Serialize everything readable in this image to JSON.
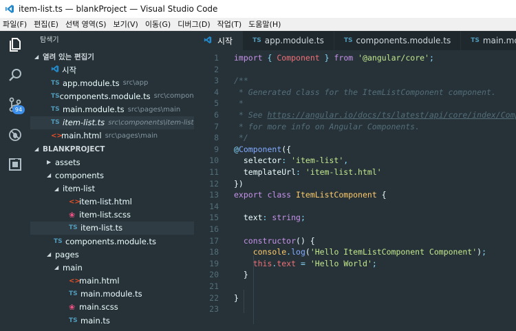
{
  "window": {
    "title": "item-list.ts — blankProject — Visual Studio Code"
  },
  "menu": [
    "파일(F)",
    "편집(E)",
    "선택 영역(S)",
    "보기(V)",
    "이동(G)",
    "디버그(D)",
    "작업(T)",
    "도움말(H)"
  ],
  "activity": {
    "items": [
      "explorer-icon",
      "search-icon",
      "source-control-icon",
      "debug-icon",
      "extensions-icon"
    ],
    "badge": "94"
  },
  "explorer": {
    "title": "탐색기",
    "open_editors_header": "열려 있는 편집기",
    "open_editors": [
      {
        "icon": "vscode",
        "name": "시작",
        "desc": ""
      },
      {
        "icon": "ts",
        "name": "app.module.ts",
        "desc": "src\\app"
      },
      {
        "icon": "ts",
        "name": "components.module.ts",
        "desc": "src\\compone..."
      },
      {
        "icon": "ts",
        "name": "main.module.ts",
        "desc": "src\\pages\\main"
      },
      {
        "icon": "ts",
        "name": "item-list.ts",
        "desc": "src\\components\\item-list"
      },
      {
        "icon": "html",
        "name": "main.html",
        "desc": "src\\pages\\main"
      }
    ],
    "project_header": "BLANKPROJECT",
    "tree": [
      {
        "type": "folder",
        "name": "assets",
        "expanded": false
      },
      {
        "type": "folder",
        "name": "components",
        "expanded": true
      },
      {
        "type": "folder",
        "name": "item-list",
        "expanded": true
      },
      {
        "type": "html",
        "name": "item-list.html"
      },
      {
        "type": "scss",
        "name": "item-list.scss"
      },
      {
        "type": "ts",
        "name": "item-list.ts"
      },
      {
        "type": "ts",
        "name": "components.module.ts"
      },
      {
        "type": "folder",
        "name": "pages",
        "expanded": true
      },
      {
        "type": "folder",
        "name": "main",
        "expanded": true
      },
      {
        "type": "html",
        "name": "main.html"
      },
      {
        "type": "ts",
        "name": "main.module.ts"
      },
      {
        "type": "scss",
        "name": "main.scss"
      },
      {
        "type": "ts",
        "name": "main.ts"
      }
    ]
  },
  "tabs": [
    {
      "icon": "vscode",
      "label": "시작",
      "active": true
    },
    {
      "icon": "ts",
      "label": "app.module.ts",
      "active": false
    },
    {
      "icon": "ts",
      "label": "components.module.ts",
      "active": false
    },
    {
      "icon": "ts",
      "label": "main.mo",
      "active": false
    }
  ],
  "editor": {
    "lines": [
      [
        [
          "kw",
          "import"
        ],
        [
          "plain",
          " "
        ],
        [
          "pun",
          "{"
        ],
        [
          "plain",
          " "
        ],
        [
          "prop",
          "Component"
        ],
        [
          "plain",
          " "
        ],
        [
          "pun",
          "}"
        ],
        [
          "plain",
          " "
        ],
        [
          "kw",
          "from"
        ],
        [
          "plain",
          " "
        ],
        [
          "str",
          "'@angular/core'"
        ],
        [
          "pun",
          ";"
        ]
      ],
      [],
      [
        [
          "cm",
          "/**"
        ]
      ],
      [
        [
          "cm",
          " * Generated class for the ItemListComponent component."
        ]
      ],
      [
        [
          "cm",
          " *"
        ]
      ],
      [
        [
          "cm",
          " * See "
        ],
        [
          "lnk",
          "https://angular.io/docs/ts/latest/api/core/index/Compo"
        ]
      ],
      [
        [
          "cm",
          " * for more info on Angular Components."
        ]
      ],
      [
        [
          "cm",
          " */"
        ]
      ],
      [
        [
          "pun",
          "@"
        ],
        [
          "dec",
          "Component"
        ],
        [
          "plain",
          "({"
        ]
      ],
      [
        [
          "plain",
          "  selector"
        ],
        [
          "pun",
          ":"
        ],
        [
          "plain",
          " "
        ],
        [
          "str",
          "'item-list'"
        ],
        [
          "pun",
          ","
        ]
      ],
      [
        [
          "plain",
          "  templateUrl"
        ],
        [
          "pun",
          ":"
        ],
        [
          "plain",
          " "
        ],
        [
          "str",
          "'item-list.html'"
        ]
      ],
      [
        [
          "plain",
          "})"
        ]
      ],
      [
        [
          "kw",
          "export"
        ],
        [
          "plain",
          " "
        ],
        [
          "kw",
          "class"
        ],
        [
          "plain",
          " "
        ],
        [
          "cls",
          "ItemListComponent"
        ],
        [
          "plain",
          " {"
        ]
      ],
      [],
      [
        [
          "plain",
          "  text"
        ],
        [
          "pun",
          ":"
        ],
        [
          "plain",
          " "
        ],
        [
          "kw",
          "string"
        ],
        [
          "pun",
          ";"
        ]
      ],
      [],
      [
        [
          "plain",
          "  "
        ],
        [
          "kw",
          "constructor"
        ],
        [
          "plain",
          "() {"
        ]
      ],
      [
        [
          "plain",
          "    "
        ],
        [
          "cls",
          "console"
        ],
        [
          "pun",
          "."
        ],
        [
          "fn",
          "log"
        ],
        [
          "plain",
          "("
        ],
        [
          "str",
          "'Hello ItemListComponent Component'"
        ],
        [
          "plain",
          ")"
        ],
        [
          "pun",
          ";"
        ]
      ],
      [
        [
          "plain",
          "    "
        ],
        [
          "prop",
          "this"
        ],
        [
          "pun",
          "."
        ],
        [
          "prop",
          "text"
        ],
        [
          "plain",
          " "
        ],
        [
          "pun",
          "="
        ],
        [
          "plain",
          " "
        ],
        [
          "str",
          "'Hello World'"
        ],
        [
          "pun",
          ";"
        ]
      ],
      [
        [
          "plain",
          "  }"
        ]
      ],
      [],
      [
        [
          "plain",
          "}"
        ]
      ],
      []
    ]
  },
  "colors": {
    "accent": "#3b8eea",
    "background": "#263238",
    "sidebar": "#263238",
    "tabbar": "#1e282d"
  }
}
